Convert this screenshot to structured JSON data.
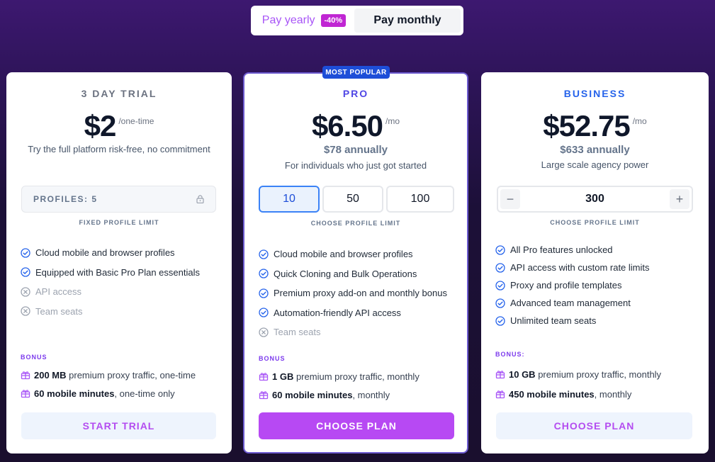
{
  "billing_toggle": {
    "yearly_label": "Pay yearly",
    "discount": "-40%",
    "monthly_label": "Pay monthly"
  },
  "plans": {
    "trial": {
      "name": "3 DAY TRIAL",
      "price": "$2",
      "period": "/one-time",
      "tagline": "Try the full platform risk-free, no commitment",
      "profiles_box": "PROFILES: 5",
      "limit_label": "FIXED PROFILE LIMIT",
      "features": [
        {
          "text": "Cloud mobile and browser profiles",
          "enabled": true
        },
        {
          "text": "Equipped with Basic Pro Plan essentials",
          "enabled": true
        },
        {
          "text": "API access",
          "enabled": false
        },
        {
          "text": "Team seats",
          "enabled": false
        }
      ],
      "bonus_label": "BONUS",
      "bonus": [
        {
          "strong": "200 MB",
          "rest": " premium proxy traffic, one-time"
        },
        {
          "strong": "60 mobile minutes",
          "rest": ", one-time only"
        }
      ],
      "cta": "START TRIAL"
    },
    "pro": {
      "badge": "MOST POPULAR",
      "name": "PRO",
      "price": "$6.50",
      "period": "/mo",
      "annual": "$78 annually",
      "tagline": "For individuals who just got started",
      "profile_options": [
        "10",
        "50",
        "100"
      ],
      "selected_option": "10",
      "limit_label": "CHOOSE PROFILE LIMIT",
      "features": [
        {
          "text": "Cloud mobile and browser profiles",
          "enabled": true
        },
        {
          "text": "Quick Cloning and Bulk Operations",
          "enabled": true
        },
        {
          "text": "Premium proxy add-on and monthly bonus",
          "enabled": true
        },
        {
          "text": "Automation-friendly API access",
          "enabled": true
        },
        {
          "text": "Team seats",
          "enabled": false
        }
      ],
      "bonus_label": "BONUS",
      "bonus": [
        {
          "strong": "1 GB",
          "rest": " premium proxy traffic, monthly"
        },
        {
          "strong": "60 mobile minutes",
          "rest": ", monthly"
        }
      ],
      "cta": "CHOOSE PLAN"
    },
    "business": {
      "name": "BUSINESS",
      "price": "$52.75",
      "period": "/mo",
      "annual": "$633 annually",
      "tagline": "Large scale agency power",
      "stepper_value": "300",
      "stepper_minus": "−",
      "stepper_plus": "+",
      "limit_label": "CHOOSE PROFILE LIMIT",
      "features": [
        {
          "text": "All Pro features unlocked",
          "enabled": true
        },
        {
          "text": "API access with custom rate limits",
          "enabled": true
        },
        {
          "text": "Proxy and profile templates",
          "enabled": true
        },
        {
          "text": "Advanced team management",
          "enabled": true
        },
        {
          "text": "Unlimited team seats",
          "enabled": true
        }
      ],
      "bonus_label": "BONUS:",
      "bonus": [
        {
          "strong": "10 GB",
          "rest": " premium proxy traffic, monthly"
        },
        {
          "strong": "450 mobile minutes",
          "rest": ", monthly"
        }
      ],
      "cta": "CHOOSE PLAN"
    }
  },
  "colors": {
    "accent": "#b749f3",
    "check": "#2563eb",
    "disabled": "#9ca3af"
  },
  "icons": {
    "enabled_feature": "check-circle-icon",
    "disabled_feature": "x-circle-icon",
    "bonus": "gift-icon",
    "locked": "lock-icon"
  }
}
